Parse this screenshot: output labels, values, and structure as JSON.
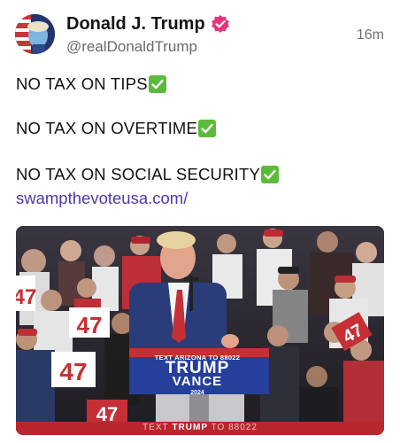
{
  "author": {
    "display_name": "Donald J. Trump",
    "handle": "@realDonaldTrump",
    "avatar_icon": "avatar-image",
    "verified_color": "#e8347a"
  },
  "post": {
    "timestamp": "16m",
    "lines": [
      "NO TAX ON TIPS",
      "NO TAX ON OVERTIME",
      "NO TAX ON SOCIAL SECURITY"
    ],
    "link": "swampthevoteusa.com/",
    "link_color": "#4a3aa8"
  },
  "media": {
    "podium_small": "TEXT ARIZONA TO 88022",
    "podium_name1": "TRUMP",
    "podium_name2": "VANCE",
    "podium_year": "2024",
    "banner_text_1": "TEXT",
    "banner_text_2": "TRUMP",
    "banner_text_3": "TO 88022",
    "sign_number": "47"
  }
}
